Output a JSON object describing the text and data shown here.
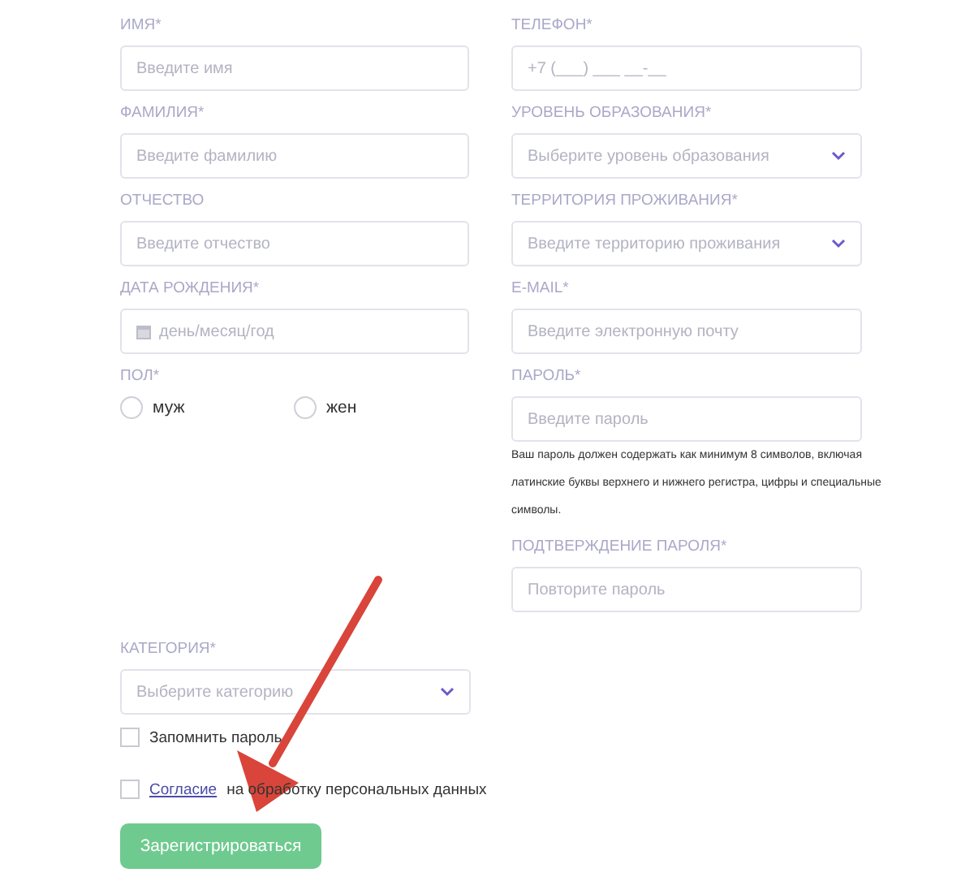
{
  "left_fields": [
    {
      "label": "ИМЯ*",
      "placeholder": "Введите имя",
      "kind": "text"
    },
    {
      "label": "ФАМИЛИЯ*",
      "placeholder": "Введите фамилию",
      "kind": "text"
    },
    {
      "label": "ОТЧЕСТВО",
      "placeholder": "Введите отчество",
      "kind": "text"
    },
    {
      "label": "ДАТА РОЖДЕНИЯ*",
      "placeholder": "день/месяц/год",
      "kind": "date"
    }
  ],
  "gender": {
    "label": "ПОЛ*",
    "options": [
      {
        "label": "муж",
        "selected": false
      },
      {
        "label": "жен",
        "selected": false
      }
    ]
  },
  "right_fields": [
    {
      "label": "ТЕЛЕФОН*",
      "placeholder": "+7 (___) ___ __-__",
      "kind": "text"
    },
    {
      "label": "УРОВЕНЬ ОБРАЗОВАНИЯ*",
      "placeholder": "Выберите уровень образования",
      "kind": "select"
    },
    {
      "label": "ТЕРРИТОРИЯ ПРОЖИВАНИЯ*",
      "placeholder": "Введите территорию проживания",
      "kind": "select"
    },
    {
      "label": "E-MAIL*",
      "placeholder": "Введите электронную почту",
      "kind": "text"
    },
    {
      "label": "ПАРОЛЬ*",
      "placeholder": "Введите пароль",
      "kind": "text",
      "hint": "Ваш пароль должен содержать как минимум 8 символов, включая латинские буквы верхнего и нижнего регистра, цифры и специальные символы."
    },
    {
      "label": "ПОДТВЕРЖДЕНИЕ ПАРОЛЯ*",
      "placeholder": "Повторите пароль",
      "kind": "text"
    }
  ],
  "category": {
    "label": "КАТЕГОРИЯ*",
    "placeholder": "Выберите категорию",
    "kind": "select"
  },
  "checkboxes": [
    {
      "text": "Запомнить пароль",
      "checked": false
    },
    {
      "link": "Согласие",
      "text": "на обработку персональных данных",
      "checked": false
    }
  ],
  "submit": "Зарегистрироваться"
}
